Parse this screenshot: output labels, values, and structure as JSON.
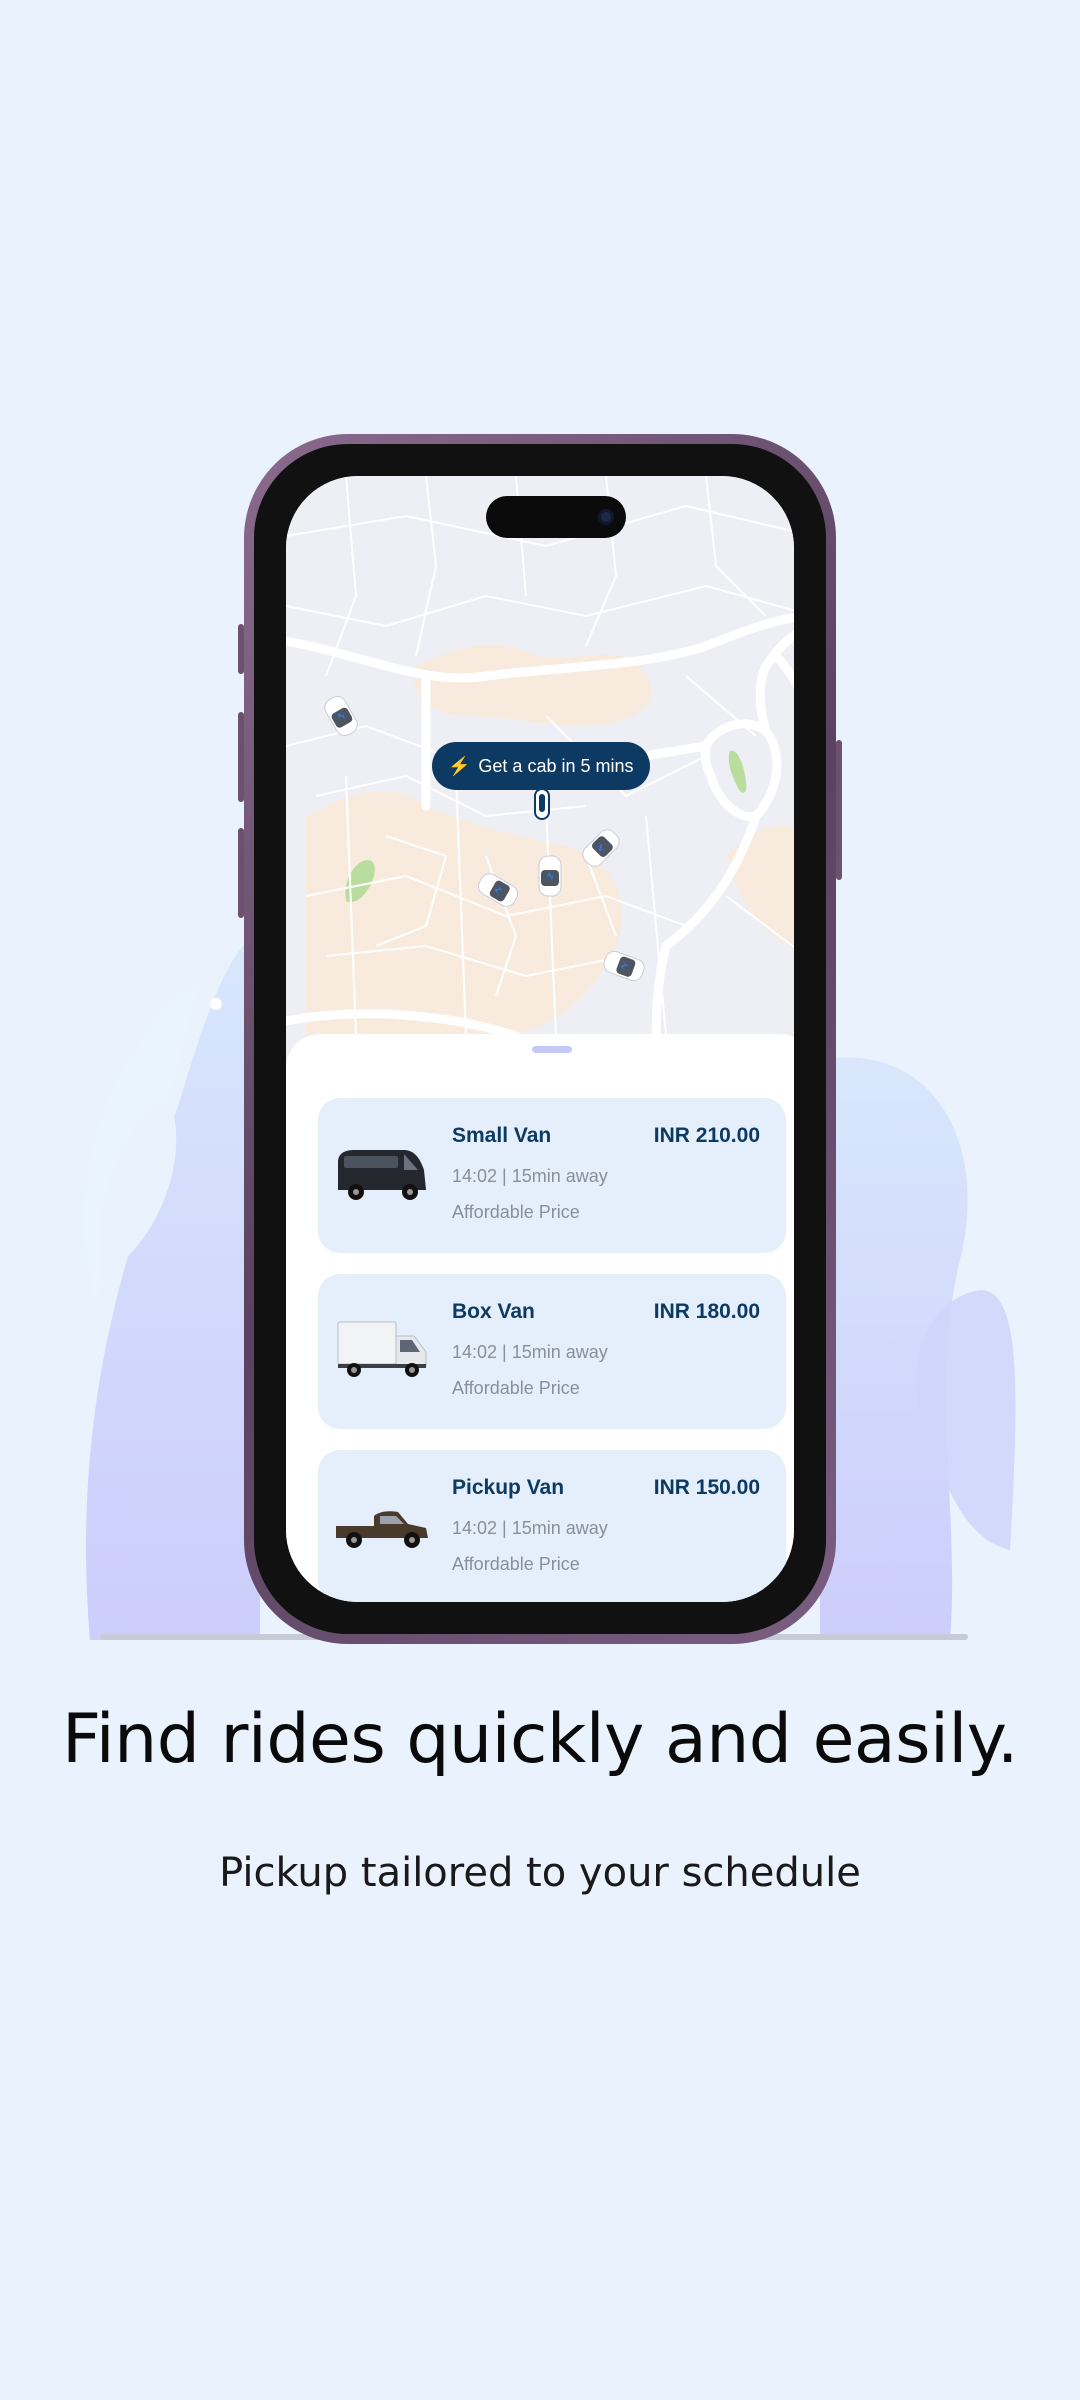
{
  "map": {
    "cab_pill_label": "Get a cab in 5 mins",
    "cab_pill_icon": "lightning-icon"
  },
  "rides": [
    {
      "name": "Small Van",
      "price": "INR 210.00",
      "time": "14:02 | 15min away",
      "tag": "Affordable Price",
      "image": "small-van-image"
    },
    {
      "name": "Box Van",
      "price": "INR 180.00",
      "time": "14:02 | 15min away",
      "tag": "Affordable Price",
      "image": "box-van-image"
    },
    {
      "name": "Pickup Van",
      "price": "INR 150.00",
      "time": "14:02 | 15min away",
      "tag": "Affordable Price",
      "image": "pickup-van-image"
    }
  ],
  "onboarding": {
    "title": "Find rides quickly and easily.",
    "subtitle": "Pickup tailored to your schedule"
  },
  "colors": {
    "background": "#eaf3fd",
    "primary": "#0d3a63",
    "card": "#e4effb",
    "muted_text": "#8a8f99",
    "blob": "#c9ccfb"
  }
}
